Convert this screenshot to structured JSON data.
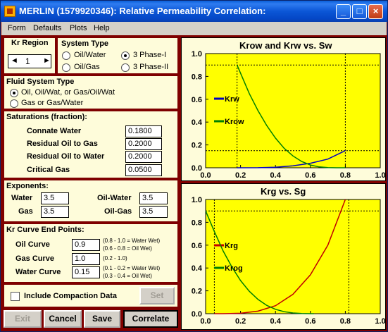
{
  "window": {
    "title": "MERLIN (1579920346): Relative Permeability Correlation:"
  },
  "menu": [
    "Form",
    "Defaults",
    "Plots",
    "Help"
  ],
  "kr_region": {
    "label": "Kr Region",
    "value": "1"
  },
  "system_type": {
    "label": "System Type",
    "options": [
      "Oil/Water",
      "3 Phase-I",
      "Oil/Gas",
      "3 Phase-II"
    ],
    "selected": "3 Phase-I"
  },
  "fluid_system": {
    "label": "Fluid System Type",
    "options": [
      "Oil, Oil/Wat, or Gas/Oil/Wat",
      "Gas or Gas/Water"
    ],
    "selected": "Oil, Oil/Wat, or Gas/Oil/Wat"
  },
  "saturations": {
    "label": "Saturations (fraction):",
    "rows": [
      {
        "name": "Connate Water",
        "value": "0.1800"
      },
      {
        "name": "Residual Oil to Gas",
        "value": "0.2000"
      },
      {
        "name": "Residual Oil to Water",
        "value": "0.2000"
      },
      {
        "name": "Critical Gas",
        "value": "0.0500"
      }
    ]
  },
  "exponents": {
    "label": "Exponents:",
    "water_label": "Water",
    "water": "3.5",
    "gas_label": "Gas",
    "gas": "3.5",
    "oilwater_label": "Oil-Water",
    "oilwater": "3.5",
    "oilgas_label": "Oil-Gas",
    "oilgas": "3.5"
  },
  "endpoints": {
    "label": "Kr Curve End Points:",
    "oil_label": "Oil Curve",
    "oil": "0.9",
    "oil_hint1": "(0.8 - 1.0 = Water Wet)",
    "oil_hint2": "(0.6 - 0.8 = Oil Wet)",
    "gas_label": "Gas Curve",
    "gas": "1.0",
    "gas_hint": "(0.2 - 1.0)",
    "water_label": "Water Curve",
    "water": "0.15",
    "water_hint1": "(0.1 - 0.2 = Water Wet)",
    "water_hint2": "(0.3 - 0.4 = Oil Wet)"
  },
  "compaction": {
    "label": "Include Compaction Data",
    "checked": false,
    "set_label": "Set"
  },
  "buttons": {
    "exit": "Exit",
    "cancel": "Cancel",
    "save": "Save",
    "correlate": "Correlate"
  },
  "colors": {
    "accent": "#800000",
    "panel": "#fefcda",
    "plot": "#ffff00",
    "green": "#008000",
    "red": "#c00000",
    "blue": "#0000c0"
  },
  "chart_data": [
    {
      "type": "line",
      "title": "Krow and Krw vs. Sw",
      "xlim": [
        0,
        1
      ],
      "ylim": [
        0,
        1
      ],
      "xticks": [
        "0.0",
        "0.2",
        "0.4",
        "0.6",
        "0.8",
        "1.0"
      ],
      "yticks": [
        "0.0",
        "0.2",
        "0.4",
        "0.6",
        "0.8",
        "1.0"
      ],
      "series": [
        {
          "name": "Krw",
          "color": "#0000c0",
          "x": [
            0.18,
            0.3,
            0.4,
            0.5,
            0.6,
            0.7,
            0.8
          ],
          "y": [
            0,
            0.0006,
            0.0052,
            0.0172,
            0.0398,
            0.0758,
            0.15
          ]
        },
        {
          "name": "Krow",
          "color": "#008000",
          "x": [
            0.18,
            0.25,
            0.3,
            0.35,
            0.4,
            0.45,
            0.5,
            0.55,
            0.6,
            0.65,
            0.7,
            0.75,
            0.8
          ],
          "y": [
            0.9,
            0.65,
            0.5,
            0.37,
            0.26,
            0.17,
            0.104,
            0.055,
            0.024,
            0.0073,
            0.0011,
            2e-05,
            0
          ]
        }
      ],
      "reference_lines": {
        "x": [
          0.18,
          0.8
        ],
        "y": [
          0.9,
          0.15
        ]
      }
    },
    {
      "type": "line",
      "title": "Krg vs. Sg",
      "xlim": [
        0,
        1
      ],
      "ylim": [
        0,
        1
      ],
      "xticks": [
        "0.0",
        "0.2",
        "0.4",
        "0.6",
        "0.8",
        "1.0"
      ],
      "yticks": [
        "0.0",
        "0.2",
        "0.4",
        "0.6",
        "0.8",
        "1.0"
      ],
      "series": [
        {
          "name": "Krg",
          "color": "#c00000",
          "x": [
            0.05,
            0.1,
            0.2,
            0.3,
            0.4,
            0.5,
            0.6,
            0.7,
            0.8
          ],
          "y": [
            0,
            0.0002,
            0.004,
            0.022,
            0.07,
            0.17,
            0.34,
            0.6,
            1.0
          ]
        },
        {
          "name": "Krog",
          "color": "#008000",
          "x": [
            0,
            0.05,
            0.1,
            0.15,
            0.2,
            0.25,
            0.3,
            0.35,
            0.4,
            0.45,
            0.5,
            0.55,
            0.6,
            0.62
          ],
          "y": [
            0.9,
            0.72,
            0.55,
            0.41,
            0.29,
            0.196,
            0.125,
            0.073,
            0.038,
            0.017,
            0.006,
            0.0015,
            0.0001,
            0
          ]
        }
      ],
      "reference_lines": {
        "x": [
          0.05,
          0.82
        ],
        "y": [
          0.9
        ]
      }
    }
  ]
}
